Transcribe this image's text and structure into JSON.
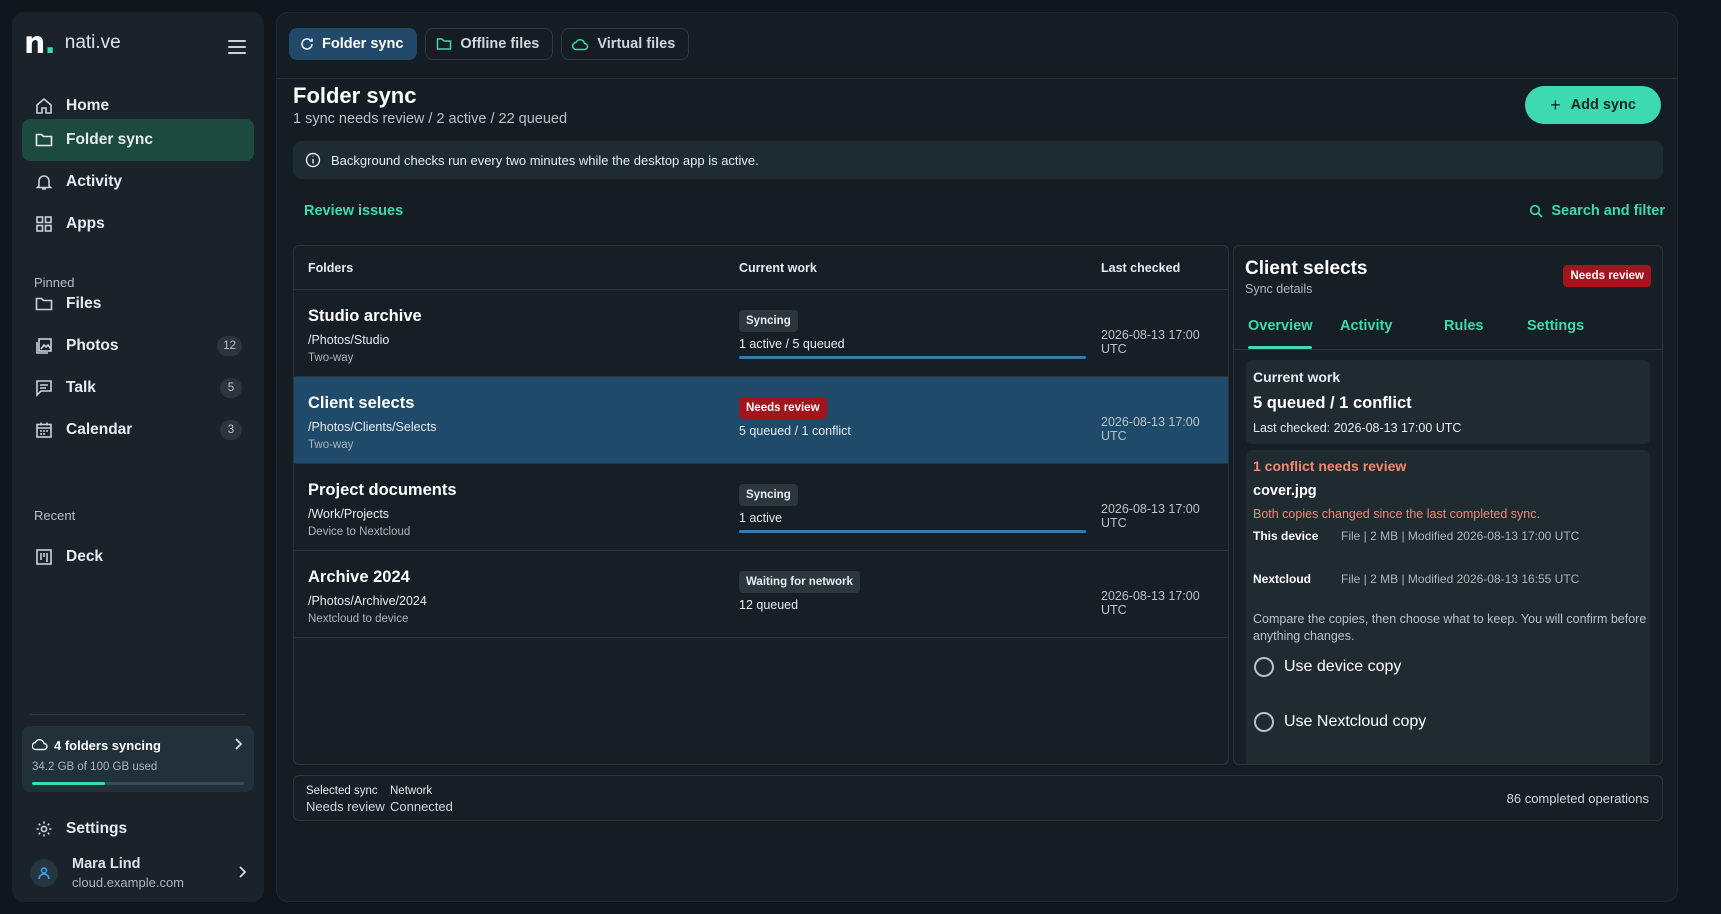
{
  "brand": {
    "name": "nati.ve"
  },
  "sidebar": {
    "nav": [
      {
        "label": "Home",
        "icon": "home-icon"
      },
      {
        "label": "Folder sync",
        "icon": "folder-icon",
        "active": true
      },
      {
        "label": "Activity",
        "icon": "bell-icon"
      },
      {
        "label": "Apps",
        "icon": "apps-grid-icon"
      }
    ],
    "pinned_label": "Pinned",
    "pinned": [
      {
        "label": "Files",
        "icon": "folder-icon",
        "badge": ""
      },
      {
        "label": "Photos",
        "icon": "photos-icon",
        "badge": "12"
      },
      {
        "label": "Talk",
        "icon": "chat-icon",
        "badge": "5"
      },
      {
        "label": "Calendar",
        "icon": "calendar-icon",
        "badge": "3"
      }
    ],
    "recent_label": "Recent",
    "recent": [
      {
        "label": "Deck",
        "icon": "deck-icon"
      }
    ],
    "storage": {
      "title": "4 folders syncing",
      "usage": "34.2 GB of 100 GB used",
      "used_fraction": 0.342
    },
    "settings_label": "Settings",
    "user": {
      "name": "Mara Lind",
      "host": "cloud.example.com"
    }
  },
  "tabs": [
    {
      "label": "Folder sync",
      "icon": "sync-icon",
      "active": true
    },
    {
      "label": "Offline files",
      "icon": "folder-icon"
    },
    {
      "label": "Virtual files",
      "icon": "cloud-icon"
    }
  ],
  "page": {
    "title": "Folder sync",
    "subtitle": "1 sync needs review / 2 active / 22 queued",
    "add_button": "Add sync",
    "banner": "Background checks run every two minutes while the desktop app is active.",
    "review_link": "Review issues",
    "search_link": "Search and filter"
  },
  "table": {
    "headers": {
      "folders": "Folders",
      "work": "Current work",
      "checked": "Last checked"
    },
    "rows": [
      {
        "name": "Studio archive",
        "path": "/Photos/Studio",
        "mode": "Two-way",
        "status": "Syncing",
        "status_type": "normal",
        "work": "1 active / 5 queued",
        "progress": 1.0,
        "checked": "2026-08-13 17:00 UTC"
      },
      {
        "name": "Client selects",
        "path": "/Photos/Clients/Selects",
        "mode": "Two-way",
        "status": "Needs review",
        "status_type": "review",
        "work": "5 queued / 1 conflict",
        "progress": null,
        "checked": "2026-08-13 17:00 UTC"
      },
      {
        "name": "Project documents",
        "path": "/Work/Projects",
        "mode": "Device to Nextcloud",
        "status": "Syncing",
        "status_type": "normal",
        "work": "1 active",
        "progress": 1.0,
        "checked": "2026-08-13 17:00 UTC"
      },
      {
        "name": "Archive 2024",
        "path": "/Photos/Archive/2024",
        "mode": "Nextcloud to device",
        "status": "Waiting for network",
        "status_type": "normal",
        "work": "12 queued",
        "progress": null,
        "checked": "2026-08-13 17:00 UTC"
      }
    ]
  },
  "detail": {
    "title": "Client selects",
    "subtitle": "Sync details",
    "badge": "Needs review",
    "tabs": [
      "Overview",
      "Activity",
      "Rules",
      "Settings"
    ],
    "current_work": {
      "label": "Current work",
      "value": "5 queued / 1 conflict",
      "last_checked": "Last checked: 2026-08-13 17:00 UTC"
    },
    "conflict": {
      "title": "1 conflict needs review",
      "file": "cover.jpg",
      "warning": "Both copies changed since the last completed sync.",
      "device_label": "This device",
      "device_value": "File | 2 MB | Modified 2026-08-13 17:00 UTC",
      "cloud_label": "Nextcloud",
      "cloud_value": "File | 2 MB | Modified 2026-08-13 16:55 UTC",
      "note": "Compare the copies, then choose what to keep. You will confirm before anything changes.",
      "options": [
        "Use device copy",
        "Use Nextcloud copy"
      ]
    }
  },
  "footer": {
    "selected_label": "Selected sync",
    "selected_value": "Needs review",
    "network_label": "Network",
    "network_value": "Connected",
    "completed": "86 completed operations"
  },
  "colors": {
    "accent": "#3dd9b0",
    "selected": "#1f4a6a",
    "danger": "#a4141c"
  }
}
